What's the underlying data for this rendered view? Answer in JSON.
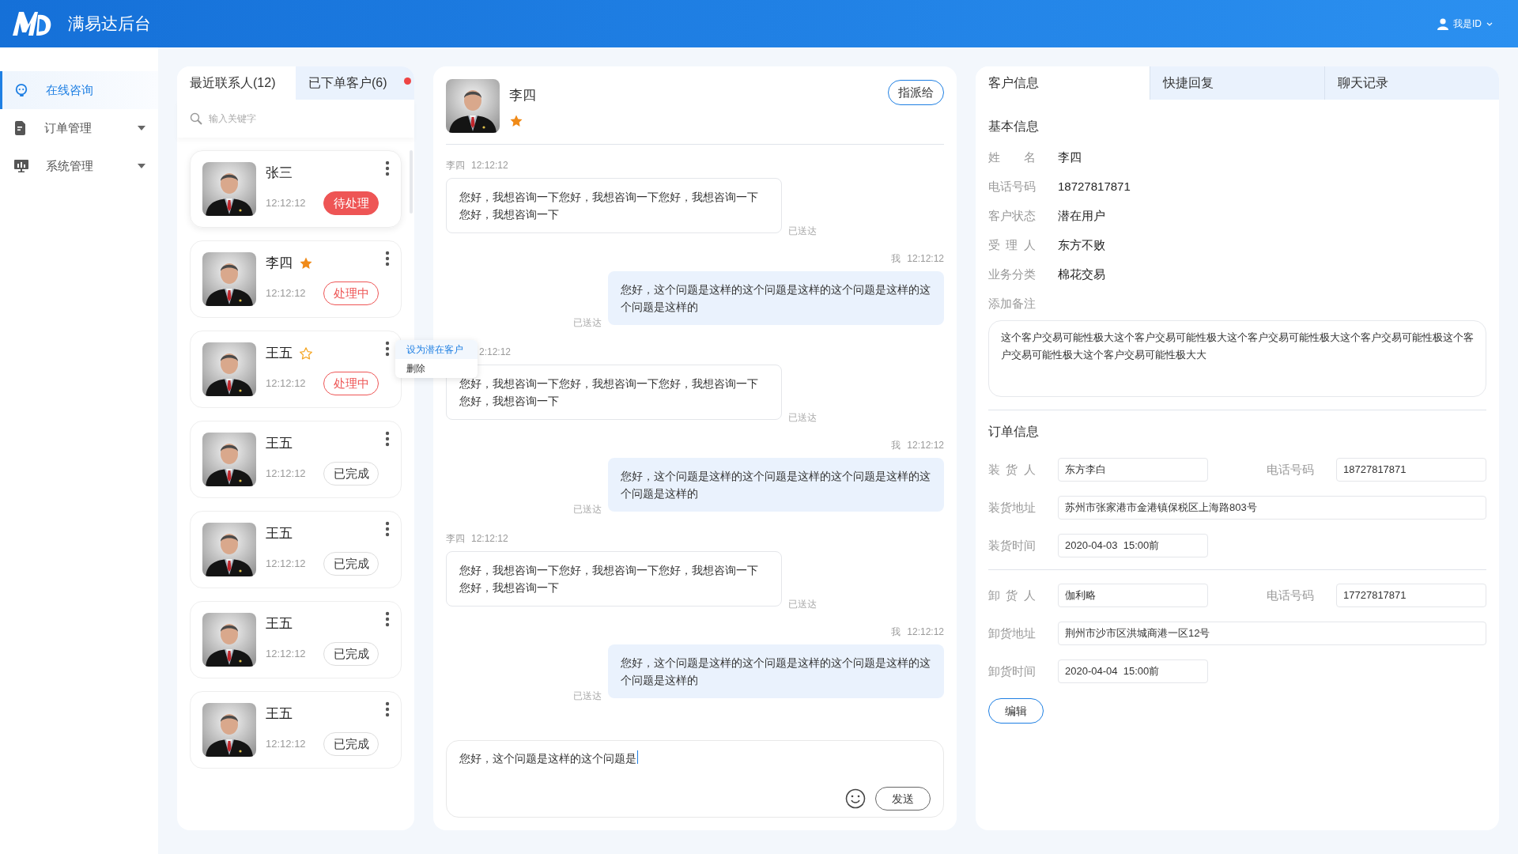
{
  "header": {
    "title": "满易达后台",
    "user": "我是ID"
  },
  "sidebar": {
    "items": [
      {
        "label": "在线咨询",
        "kind": "headset",
        "selected": true,
        "expandable": false
      },
      {
        "label": "订单管理",
        "kind": "document",
        "selected": false,
        "expandable": true
      },
      {
        "label": "系统管理",
        "kind": "monitor",
        "selected": false,
        "expandable": true
      }
    ]
  },
  "contacts": {
    "tabs": [
      {
        "label": "最近联系人(12)",
        "selected": true,
        "unread": false
      },
      {
        "label": "已下单客户(6)",
        "selected": false,
        "unread": true
      }
    ],
    "search": {
      "placeholder": "输入关键字"
    },
    "items": [
      {
        "name": "张三",
        "time": "12:12:12",
        "status": {
          "kind": "pending",
          "label": "待处理"
        }
      },
      {
        "name": "李四",
        "starred": true,
        "time": "12:12:12",
        "status": {
          "kind": "processing",
          "label": "处理中"
        }
      },
      {
        "name": "王五",
        "starred": false,
        "time": "12:12:12",
        "status": {
          "kind": "processing",
          "label": "处理中"
        }
      },
      {
        "name": "王五",
        "time": "12:12:12",
        "status": {
          "kind": "done",
          "label": "已完成"
        }
      },
      {
        "name": "王五",
        "time": "12:12:12",
        "status": {
          "kind": "done",
          "label": "已完成"
        }
      },
      {
        "name": "王五",
        "time": "12:12:12",
        "status": {
          "kind": "done",
          "label": "已完成"
        }
      },
      {
        "name": "王五",
        "time": "12:12:12",
        "status": {
          "kind": "done",
          "label": "已完成"
        }
      }
    ],
    "menu": {
      "items": [
        {
          "label": "设为潜在客户",
          "selected": true
        },
        {
          "label": "删除",
          "selected": false
        }
      ]
    }
  },
  "chat": {
    "contact": {
      "name": "李四",
      "starred": true
    },
    "assign_button": "指派给",
    "messages": [
      {
        "kind": "received",
        "sender": "李四",
        "time": "12:12:12",
        "text": "您好，我想咨询一下您好，我想咨询一下您好，我想咨询一下您好，我想咨询一下",
        "status": "已送达"
      },
      {
        "kind": "sent",
        "sender": "我",
        "time": "12:12:12",
        "text": "您好，这个问题是这样的这个问题是这样的这个问题是这样的这个问题是这样的",
        "status": "已送达"
      },
      {
        "kind": "received",
        "time": "2:12:12",
        "text": "您好，我想咨询一下您好，我想咨询一下您好，我想咨询一下您好，我想咨询一下",
        "status": "已送达"
      },
      {
        "kind": "sent",
        "sender": "我",
        "time": "12:12:12",
        "text": "您好，这个问题是这样的这个问题是这样的这个问题是这样的这个问题是这样的",
        "status": "已送达"
      },
      {
        "kind": "received",
        "sender": "李四",
        "time": "12:12:12",
        "text": "您好，我想咨询一下您好，我想咨询一下您好，我想咨询一下您好，我想咨询一下",
        "status": "已送达"
      },
      {
        "kind": "sent",
        "sender": "我",
        "time": "12:12:12",
        "text": "您好，这个问题是这样的这个问题是这样的这个问题是这样的这个问题是这样的",
        "status": "已送达"
      }
    ],
    "input": {
      "value": "您好，这个问题是这样的这个问题是"
    },
    "send_button": "发送"
  },
  "details": {
    "tabs": [
      {
        "label": "客户信息",
        "selected": true
      },
      {
        "label": "快捷回复",
        "selected": false
      },
      {
        "label": "聊天记录",
        "selected": false
      }
    ],
    "basic_title": "基本信息",
    "basic_fields": [
      {
        "label": "姓 名",
        "value": "李四"
      },
      {
        "label": "电话号码",
        "value": "18727817871"
      },
      {
        "label": "客户状态",
        "value": "潜在用户"
      },
      {
        "label": "受 理 人",
        "value": "东方不败"
      },
      {
        "label": "业务分类",
        "value": "棉花交易"
      }
    ],
    "notes_label": "添加备注",
    "notes": "这个客户交易可能性极大这个客户交易可能性极大这个客户交易可能性极大这个客户交易可能性极这个客户交易可能性极大这个客户交易可能性极大大",
    "order_title": "订单信息",
    "order_groups": [
      [
        [
          {
            "label": "装 货 人",
            "value": "东方李白",
            "kind": "short"
          },
          {
            "label": "电话号码",
            "value": "18727817871",
            "kind": "short"
          }
        ],
        [
          {
            "label": "装货地址",
            "value": "苏州市张家港市金港镇保税区上海路803号",
            "kind": "long"
          }
        ],
        [
          {
            "label": "装货时间",
            "value": "2020-04-03  15:00前",
            "kind": "short"
          }
        ]
      ],
      [
        [
          {
            "label": "卸 货 人",
            "value": "伽利略",
            "kind": "short"
          },
          {
            "label": "电话号码",
            "value": "17727817871",
            "kind": "short"
          }
        ],
        [
          {
            "label": "卸货地址",
            "value": "荆州市沙市区洪城商港一区12号",
            "kind": "long"
          }
        ],
        [
          {
            "label": "卸货时间",
            "value": "2020-04-04  15:00前",
            "kind": "short"
          }
        ]
      ]
    ],
    "edit_button": "编辑"
  }
}
